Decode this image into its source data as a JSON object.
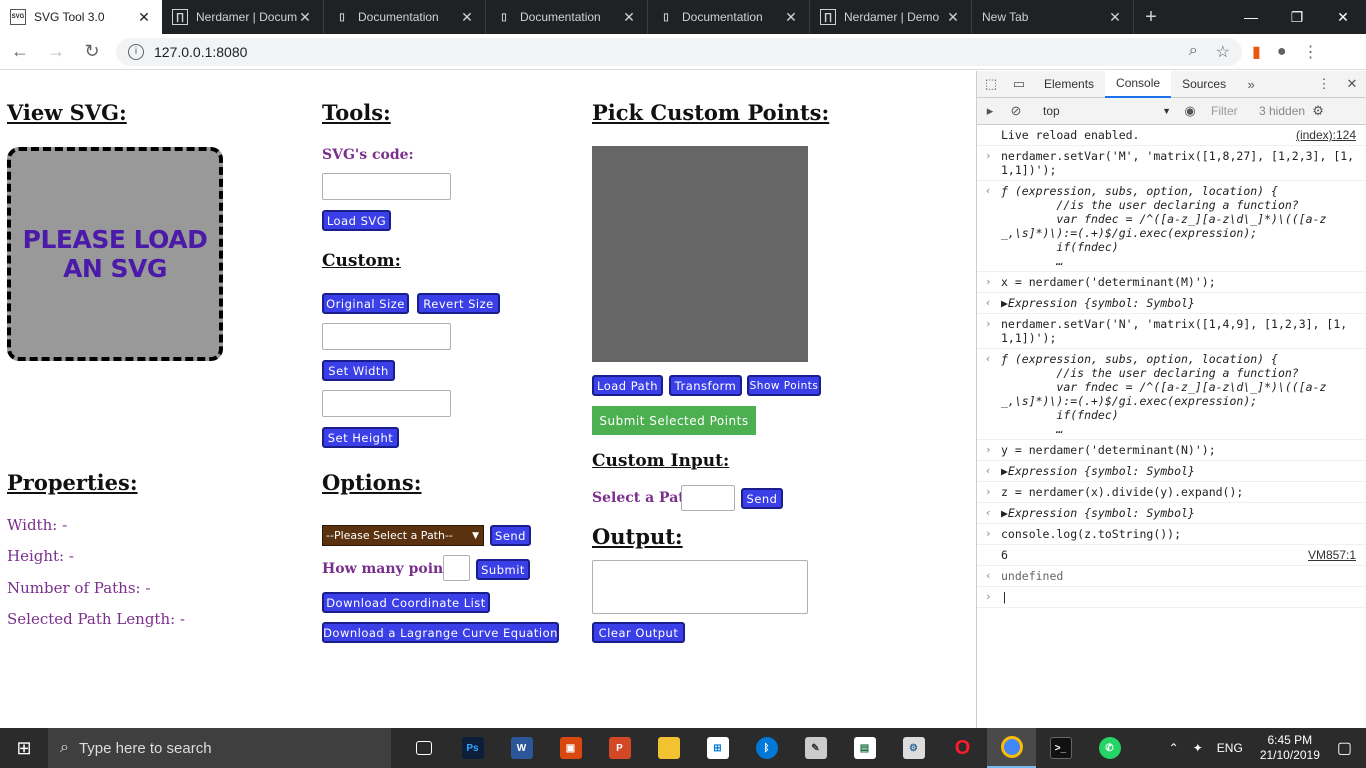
{
  "browser": {
    "tabs": [
      {
        "icon": "svg-tool-favicon",
        "label": "SVG Tool 3.0",
        "active": true
      },
      {
        "icon": "nerdamer-favicon",
        "label": "Nerdamer | Docum"
      },
      {
        "icon": "document-icon",
        "label": "Documentation"
      },
      {
        "icon": "document-icon",
        "label": "Documentation"
      },
      {
        "icon": "document-icon",
        "label": "Documentation"
      },
      {
        "icon": "nerdamer-favicon",
        "label": "Nerdamer | Demo"
      },
      {
        "icon": "",
        "label": "New Tab"
      }
    ],
    "url": "127.0.0.1:8080"
  },
  "page": {
    "view_svg_heading": "View SVG:",
    "svg_placeholder_line1": "PLEASE LOAD",
    "svg_placeholder_line2": "AN SVG",
    "tools_heading": "Tools:",
    "svg_code_label": "SVG's code:",
    "load_svg": "Load SVG",
    "custom_heading": "Custom:",
    "original_size": "Original Size",
    "revert_size": "Revert Size",
    "set_width": "Set Width",
    "set_height": "Set Height",
    "pick_heading": "Pick Custom Points:",
    "load_path": "Load Path",
    "transform": "Transform",
    "show_points": "Show Points",
    "submit_selected": "Submit Selected Points",
    "custom_input_heading": "Custom Input:",
    "select_path_label": "Select a Path:",
    "send": "Send",
    "output_heading": "Output:",
    "clear_output": "Clear Output",
    "properties_heading": "Properties:",
    "width": "Width: -",
    "height": "Height: -",
    "num_paths": "Number of Paths: -",
    "selected_len": "Selected Path Length: -",
    "options_heading": "Options:",
    "path_select": "--Please Select a Path--",
    "options_send": "Send",
    "how_many": "How many points?:",
    "submit": "Submit",
    "download_coords": "Download Coordinate List",
    "download_lagrange": "Download a Lagrange Curve Equation"
  },
  "devtools": {
    "tabs": [
      "Elements",
      "Console",
      "Sources"
    ],
    "active_tab": "Console",
    "context": "top",
    "filter_placeholder": "Filter",
    "hidden_count": "3 hidden",
    "console": {
      "l1": "Live reload enabled.",
      "l1_src": "(index):124",
      "l2": "nerdamer.setVar('M', 'matrix([1,8,27], [1,2,3], [1,1,1])');",
      "l3": "ƒ (expression, subs, option, location) {\n        //is the user declaring a function?\n        var fndec = /^([a-z_][a-z\\d\\_]*)\\(([a-z_,\\s]*)\\):=(.+)$/gi.exec(expression);\n        if(fndec)\n        …",
      "l4": "x = nerdamer('determinant(M)');",
      "l5": "▶Expression {symbol: Symbol}",
      "l6": "nerdamer.setVar('N', 'matrix([1,4,9], [1,2,3], [1,1,1])');",
      "l7": "ƒ (expression, subs, option, location) {\n        //is the user declaring a function?\n        var fndec = /^([a-z_][a-z\\d\\_]*)\\(([a-z_,\\s]*)\\):=(.+)$/gi.exec(expression);\n        if(fndec)\n        …",
      "l8": "y = nerdamer('determinant(N)');",
      "l9": "▶Expression {symbol: Symbol}",
      "l10": "z = nerdamer(x).divide(y).expand();",
      "l11": "▶Expression {symbol: Symbol}",
      "l12": "console.log(z.toString());",
      "l13": "6",
      "l13_src": "VM857:1",
      "l14": "undefined"
    }
  },
  "taskbar": {
    "search_placeholder": "Type here to search",
    "lang": "ENG",
    "time": "6:45 PM",
    "date": "21/10/2019"
  }
}
